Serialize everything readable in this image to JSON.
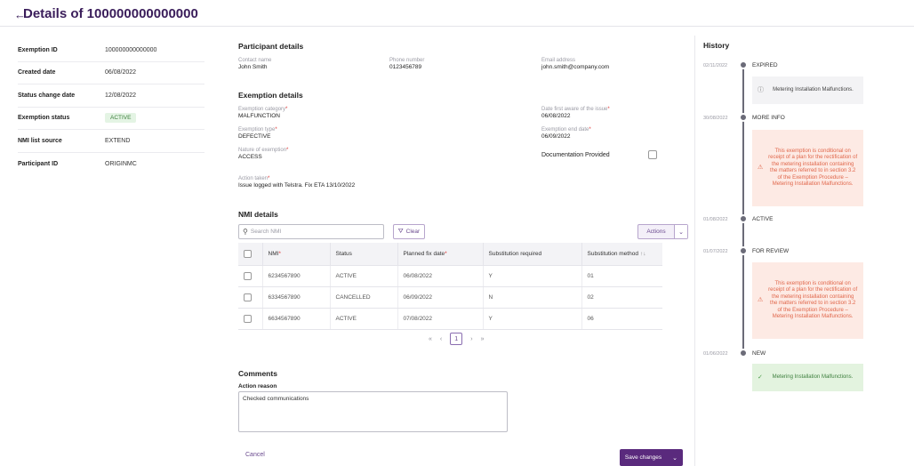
{
  "header": {
    "title": "Details of 100000000000000"
  },
  "summary": [
    {
      "label": "Exemption ID",
      "value": "100000000000000"
    },
    {
      "label": "Created date",
      "value": "06/08/2022"
    },
    {
      "label": "Status change date",
      "value": "12/08/2022"
    },
    {
      "label": "Exemption status",
      "value": "ACTIVE"
    },
    {
      "label": "NMI list source",
      "value": "EXTEND"
    },
    {
      "label": "Participant ID",
      "value": "ORIGINMC"
    }
  ],
  "participant": {
    "title": "Participant details",
    "contact_label": "Contact name",
    "contact_value": "John Smith",
    "phone_label": "Phone number",
    "phone_value": "0123456789",
    "email_label": "Email address",
    "email_value": "john.smith@company.com"
  },
  "exemption": {
    "title": "Exemption details",
    "category_label": "Exemption category",
    "category_value": "MALFUNCTION",
    "type_label": "Exemption type",
    "type_value": "DEFECTIVE",
    "nature_label": "Nature of exemption",
    "nature_value": "ACCESS",
    "action_label": "Action taken",
    "action_value": "Issue logged with Telstra. Fix ETA 13/10/2022",
    "aware_label": "Date first aware of the issue",
    "aware_value": "06/08/2022",
    "end_label": "Exemption end date",
    "end_value": "06/09/2022",
    "doc_label": "Documentation Provided"
  },
  "nmi": {
    "title": "NMI details",
    "search_placeholder": "Search NMI",
    "clear_label": "Clear",
    "actions_label": "Actions",
    "columns": [
      "NMI",
      "Status",
      "Planned fix date",
      "Substitution required",
      "Substitution method"
    ],
    "rows": [
      [
        "6234567890",
        "ACTIVE",
        "06/08/2022",
        "Y",
        "01"
      ],
      [
        "6334567890",
        "CANCELLED",
        "06/09/2022",
        "N",
        "02"
      ],
      [
        "6634567890",
        "ACTIVE",
        "07/08/2022",
        "Y",
        "06"
      ]
    ],
    "pager": {
      "first": "«",
      "prev": "‹",
      "page": "1",
      "next": "›",
      "last": "»"
    }
  },
  "comments": {
    "title": "Comments",
    "reason_label": "Action reason",
    "reason_value": "Checked communications"
  },
  "footer": {
    "cancel_label": "Cancel",
    "save_label": "Save changes"
  },
  "history": {
    "title": "History",
    "entries": [
      {
        "date": "02/11/2022",
        "status": "EXPIRED",
        "note": "Metering Installation Malfunctions."
      },
      {
        "date": "30/08/2022",
        "status": "MORE INFO",
        "note": "This exemption is conditional on receipt of a plan for the rectification of the metering installation containing the matters referred to in section 3.2 of the Exemption Procedure – Metering Installation Malfunctions."
      },
      {
        "date": "01/08/2022",
        "status": "ACTIVE"
      },
      {
        "date": "01/07/2022",
        "status": "FOR REVIEW",
        "note": "This exemption is conditional on receipt of a plan for the rectification of the metering installation containing the matters referred to in section 3.2 of the Exemption Procedure – Metering Installation Malfunctions."
      },
      {
        "date": "01/06/2022",
        "status": "NEW",
        "note": "Metering Installation Malfunctions."
      }
    ]
  },
  "colors": {
    "brand": "#5a2a7d",
    "success": "#3d7f3d",
    "warning": "#e0664a"
  },
  "icons": [
    "back-arrow-icon",
    "search-icon",
    "filter-icon",
    "chevron-down-icon",
    "sort-icon",
    "info-icon",
    "warning-icon",
    "check-icon"
  ]
}
